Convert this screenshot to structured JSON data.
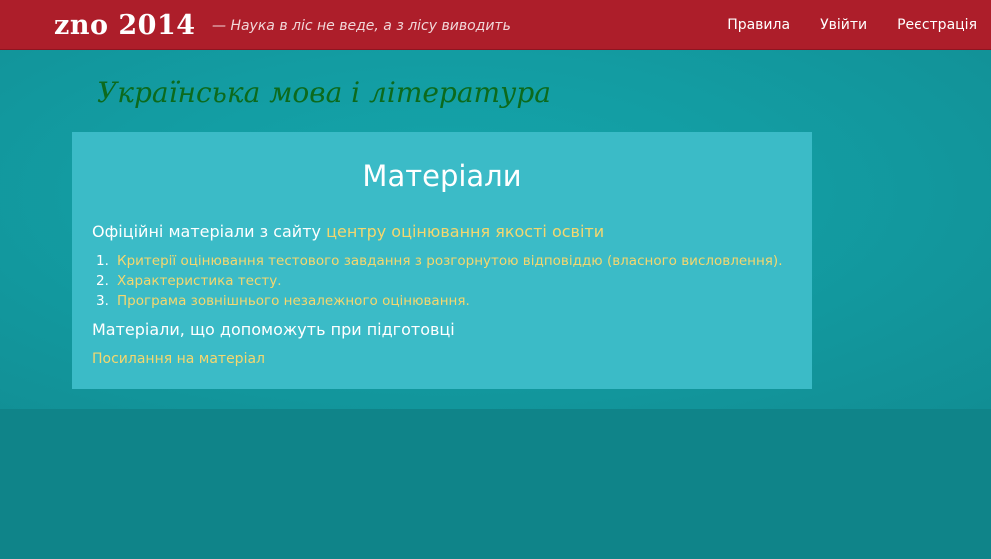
{
  "header": {
    "logo": "zno 2014",
    "tagline": "— Наука в ліс не веде, а з лісу виводить",
    "nav": [
      {
        "label": "Правила"
      },
      {
        "label": "Увійти"
      },
      {
        "label": "Реєстрація"
      }
    ]
  },
  "subject": {
    "title": "Українська мова і література"
  },
  "materials": {
    "title": "Матеріали",
    "official_heading_prefix": "Офіційні матеріали з сайту",
    "official_heading_link": "центру оцінювання якості освіти",
    "official_items": [
      {
        "number": "1.",
        "label": "Критерії оцінювання тестового завдання з розгорнутою відповіддю (власного висловлення)."
      },
      {
        "number": "2.",
        "label": "Характеристика тесту."
      },
      {
        "number": "3.",
        "label": "Програма зовнішнього незалежного оцінювання."
      }
    ],
    "prep_heading": "Матеріали, що допоможуть при підготовці",
    "prep_link": "Посилання на матеріал"
  },
  "colors": {
    "header_bg": "#ad1e2a",
    "band_bg": "#14a5ab",
    "page_bg": "#0f8489",
    "panel_bg": "#3bbbc7",
    "link": "#f5d76e",
    "subject_title": "#0c6a1d"
  }
}
